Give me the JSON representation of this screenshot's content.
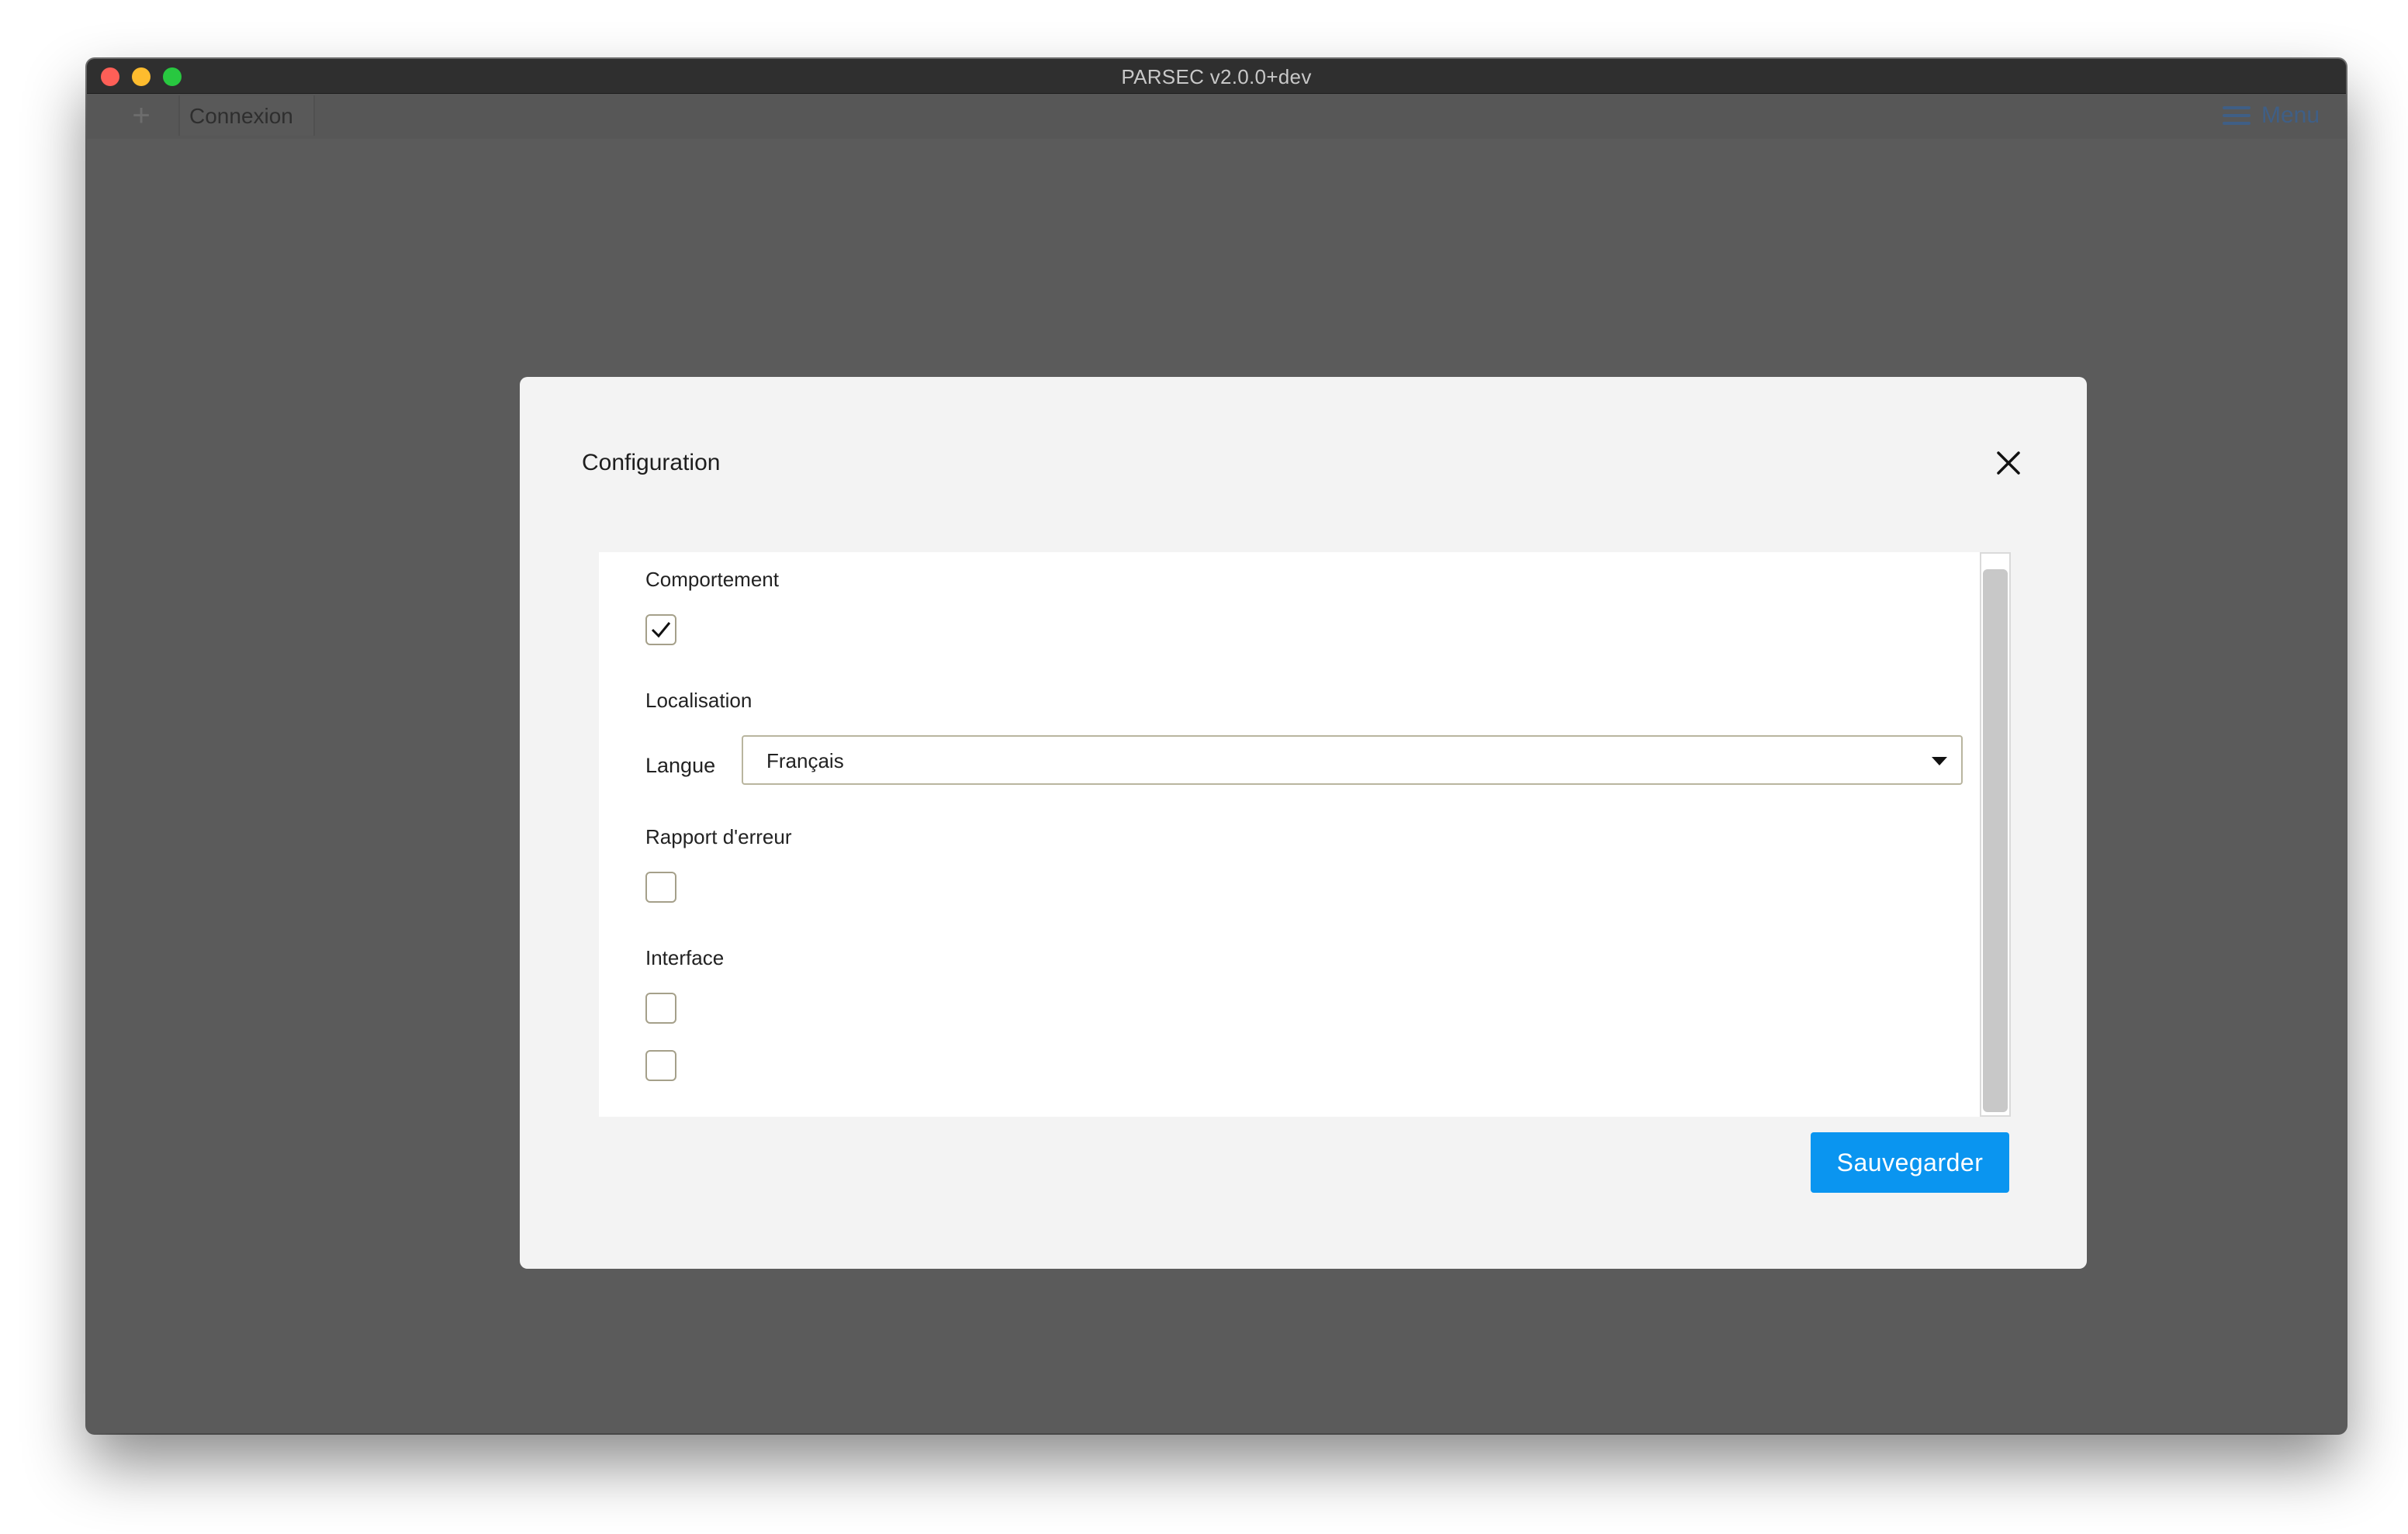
{
  "window": {
    "title": "PARSEC v2.0.0+dev"
  },
  "tabbar": {
    "add_label": "+",
    "active_tab": "Connexion",
    "menu_label": "Menu"
  },
  "dialog": {
    "title": "Configuration",
    "sections": {
      "behavior": {
        "label": "Comportement",
        "checked": true
      },
      "localisation": {
        "label": "Localisation",
        "language_label": "Langue",
        "language_value": "Français"
      },
      "error_report": {
        "label": "Rapport d'erreur",
        "checked": false
      },
      "interface": {
        "label": "Interface",
        "option1_checked": false,
        "option2_checked": false
      }
    },
    "save_label": "Sauvegarder"
  },
  "colors": {
    "accent": "#0a95f0",
    "menu": "#3f5f86",
    "overlay": "#5b5b5b"
  }
}
